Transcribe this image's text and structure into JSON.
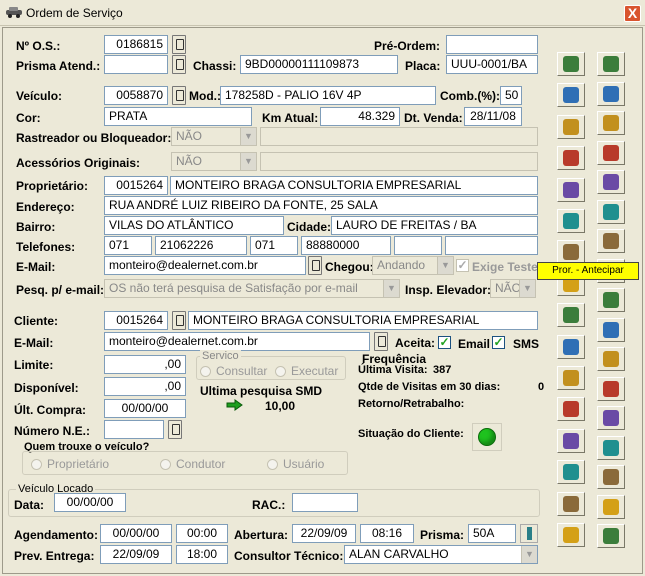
{
  "window": {
    "title": "Ordem de Serviço",
    "close_label": "X"
  },
  "labels": {
    "os": "Nº O.S.:",
    "prisma_atend": "Prisma Atend.:",
    "chassi": "Chassi:",
    "pre_ordem": "Pré-Ordem:",
    "placa": "Placa:",
    "veiculo": "Veículo:",
    "mod": "Mod.:",
    "comb": "Comb.(%):",
    "cor": "Cor:",
    "km_atual": "Km Atual:",
    "dt_venda": "Dt. Venda:",
    "rastreador": "Rastreador ou Bloqueador:",
    "acessorios": "Acessórios Originais:",
    "proprietario": "Proprietário:",
    "endereco": "Endereço:",
    "bairro": "Bairro:",
    "cidade": "Cidade:",
    "telefones": "Telefones:",
    "email": "E-Mail:",
    "chegou": "Chegou:",
    "exige_teste": "Exige Teste",
    "pesq_email": "Pesq. p/ e-mail:",
    "insp_elevador": "Insp. Elevador:",
    "cliente": "Cliente:",
    "cliente_email": "E-Mail:",
    "aceita": "Aceita:",
    "email_opt": "Email",
    "sms_opt": "SMS",
    "limite": "Limite:",
    "disponivel": "Disponível:",
    "ult_compra": "Últ. Compra:",
    "numero_ne": "Número N.E.:",
    "quem_trouxe": "Quem trouxe o veículo?",
    "situacao_cliente": "Situação do Cliente:",
    "veiculo_locado": "Veículo Locado",
    "data": "Data:",
    "rac": "RAC.:",
    "agendamento": "Agendamento:",
    "abertura": "Abertura:",
    "prisma": "Prisma:",
    "prev_entrega": "Prev. Entrega:",
    "consultor": "Consultor Técnico:"
  },
  "values": {
    "os": "0186815",
    "prisma_atend": "",
    "chassi": "9BD00000111109873",
    "pre_ordem": "",
    "placa": "UUU-0001/BA",
    "veiculo": "0058870",
    "mod": "178258D - PALIO 16V 4P",
    "comb": "50",
    "cor": "PRATA",
    "km_atual": "48.329",
    "dt_venda": "28/11/08",
    "rastreador": "NÃO",
    "acessorios": "NÃO",
    "prop_codigo": "0015264",
    "prop_nome": "MONTEIRO BRAGA CONSULTORIA EMPRESARIAL",
    "endereco": "RUA ANDRÉ LUIZ RIBEIRO DA FONTE, 25 SALA",
    "bairro": "VILAS DO ATLÂNTICO",
    "cidade": "LAURO DE FREITAS / BA",
    "tel1_ddd": "071",
    "tel1": "21062226",
    "tel2_ddd": "071",
    "tel2": "88880000",
    "email": "monteiro@dealernet.com.br",
    "chegou": "Andando",
    "pesq_email": "OS não terá pesquisa de Satisfação por e-mail",
    "insp_elevador": "NÃO",
    "cliente_codigo": "0015264",
    "cliente_nome": "MONTEIRO BRAGA CONSULTORIA EMPRESARIAL",
    "cliente_email": "monteiro@dealernet.com.br",
    "limite": ",00",
    "disponivel": ",00",
    "ult_compra": "00/00/00",
    "numero_ne": "",
    "data_locado": "00/00/00",
    "rac": "",
    "agend_data": "00/00/00",
    "agend_hora": "00:00",
    "abertura_data": "22/09/09",
    "abertura_hora": "08:16",
    "prisma": "50A",
    "prev_data": "22/09/09",
    "prev_hora": "18:00",
    "consultor": "ALAN CARVALHO"
  },
  "servico": {
    "title": "Servico",
    "consultar": "Consultar",
    "executar": "Executar",
    "ultima_pesquisa": "Ultima pesquisa SMD",
    "nota": "10,00"
  },
  "frequencia": {
    "title": "Frequência",
    "ultima_visita_label": "Última Visita:",
    "ultima_visita": "387",
    "qtde_label": "Qtde de Visitas em 30 dias:",
    "qtde": "0",
    "retorno_label": "Retorno/Retrabalho:"
  },
  "quem_trouxe_opts": {
    "proprietario": "Proprietário",
    "condutor": "Condutor",
    "usuario": "Usuário"
  },
  "checkbox": {
    "check": "✓"
  },
  "status_colors": {
    "situacao": "#1ec21e"
  },
  "tooltip": "Pror. - Antecipar",
  "toolbar_icons": {
    "left": [
      "tree-icon",
      "table-icon",
      "search-doc-icon",
      "money-icon",
      "users-icon",
      "phone-icon",
      "printer-icon",
      "list-icon",
      "smile-icon",
      "check-icon",
      "camera-icon",
      "printer2-icon",
      "clown-icon",
      "papers-icon",
      "notes-icon",
      "tools-icon"
    ],
    "right": [
      "money-bag-icon",
      "folders-icon",
      "car-icon",
      "paint-icon",
      "documents-icon",
      "clipboard-icon",
      "refresh-icon",
      "smiley-icon",
      "arm-icon",
      "transfer-icon",
      "page-icon",
      "car2-icon",
      "person-icon",
      "truck-icon",
      "list2-icon",
      "wallet-icon",
      "exit-icon"
    ]
  }
}
